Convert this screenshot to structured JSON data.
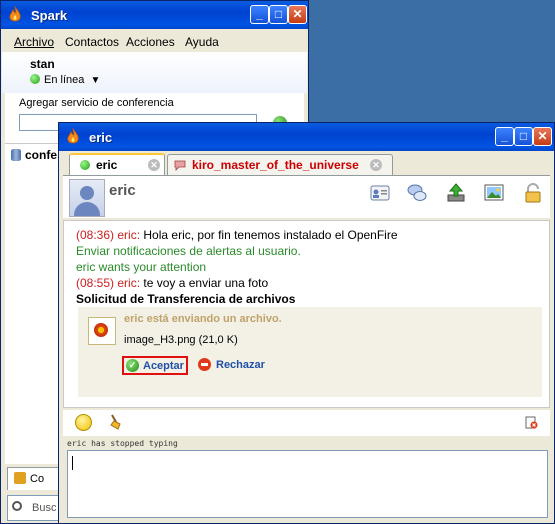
{
  "main_window": {
    "title": "Spark",
    "menu": [
      "Archivo",
      "Contactos",
      "Acciones",
      "Ayuda"
    ],
    "user": {
      "name": "stan",
      "status": "En línea"
    },
    "conference_label": "Agregar servicio de conferencia",
    "conference_input_value": "",
    "list_item": "confe",
    "bottom_tab_label": "Co",
    "search_text": "Busc"
  },
  "chat_window": {
    "title": "eric",
    "tabs": [
      {
        "label": "eric",
        "color": "#000000"
      },
      {
        "label": "kiro_master_of_the_universe",
        "color": "#cc0000"
      }
    ],
    "contact_name": "eric",
    "toolbar_icons": [
      "profile-card-icon",
      "chat-bubbles-icon",
      "send-file-icon",
      "image-icon",
      "lock-icon"
    ],
    "messages": [
      {
        "time": "(08:36)",
        "sender": "eric:",
        "text": " Hola eric, por fin tenemos instalado el OpenFire"
      },
      {
        "system": "Enviar notificaciones de alertas al usuario."
      },
      {
        "system": "eric wants your attention"
      },
      {
        "time": "(08:55)",
        "sender": "eric:",
        "text": " te voy a enviar una foto"
      },
      {
        "bold": "Solicitud de Transferencia de archivos"
      }
    ],
    "file_transfer": {
      "sending_text": "eric está enviando un archivo.",
      "file_name": "image_H3.png (21,0 K)",
      "accept_label": "Aceptar",
      "reject_label": "Rechazar"
    },
    "typing_status": "eric has stopped typing",
    "input_value": ""
  },
  "colors": {
    "timestamp": "#cc2020",
    "system_message": "#2a8a2a",
    "link_button": "#2050a8",
    "highlight_border": "#e01010"
  }
}
